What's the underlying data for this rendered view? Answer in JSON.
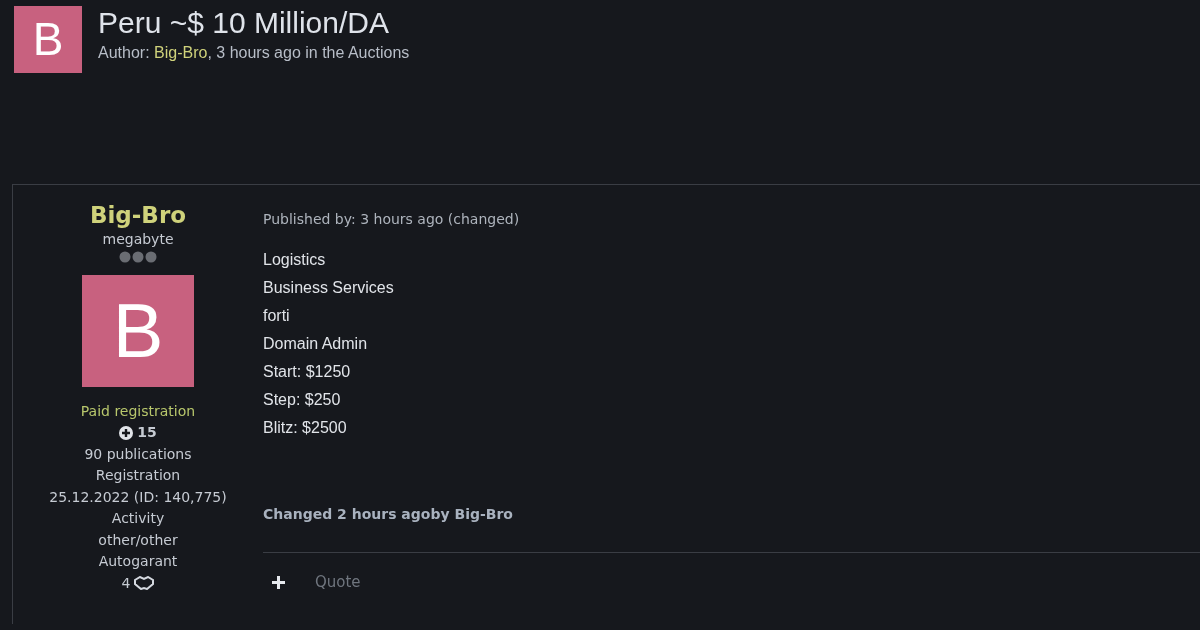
{
  "topic": {
    "avatar_letter": "B",
    "title": "Peru ~$ 10 Million/DA",
    "author_label": "Author: ",
    "author": "Big-Bro",
    "meta": ", 3 hours ago in the Auctions"
  },
  "post": {
    "user": {
      "name": "Big-Bro",
      "rank": "megabyte",
      "avatar_letter": "B",
      "group": "Paid registration",
      "reputation": "15",
      "publications": "90 publications",
      "stats": [
        {
          "kind": "text",
          "label": "Registration",
          "value": "25.12.2022 (ID: 140,775)"
        },
        {
          "kind": "text",
          "label": "Activity",
          "value": "other/other"
        },
        {
          "kind": "deals",
          "label": "Autogarant",
          "value": "4"
        }
      ]
    },
    "published": "Published by: 3 hours ago (changed)",
    "lines": [
      "Logistics",
      "Business Services",
      "forti",
      "Domain Admin",
      "Start: $1250",
      "Step: $250",
      "Blitz: $2500"
    ],
    "edited": "Changed 2 hours agoby Big-Bro",
    "quote_label": "Quote"
  }
}
